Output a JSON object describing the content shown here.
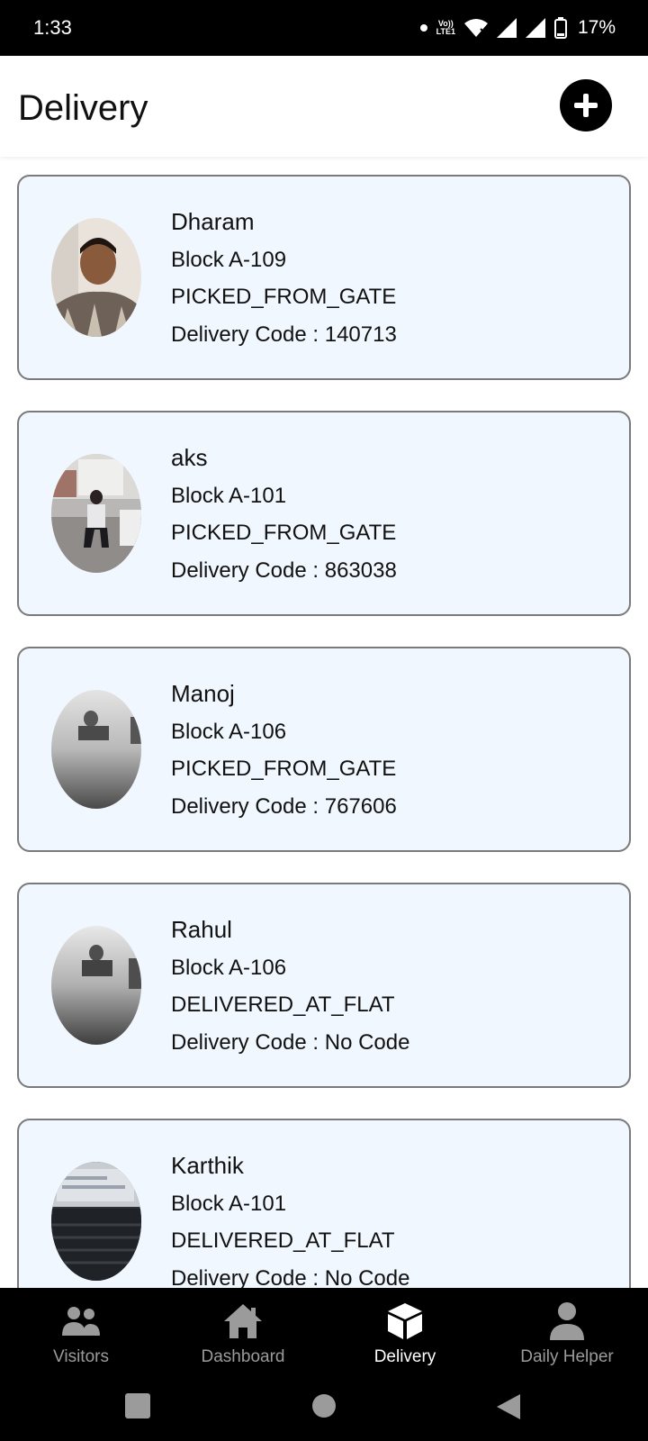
{
  "status_bar": {
    "time": "1:33",
    "network_label_top": "Vo))",
    "network_label_bottom": "LTE1",
    "battery": "17%"
  },
  "header": {
    "title": "Delivery",
    "add_icon": "plus-icon"
  },
  "deliveries": [
    {
      "name": "Dharam",
      "block": "Block A-109",
      "status": "PICKED_FROM_GATE",
      "code_label": "Delivery Code : ",
      "code": "140713"
    },
    {
      "name": "aks",
      "block": "Block A-101",
      "status": "PICKED_FROM_GATE",
      "code_label": "Delivery Code : ",
      "code": "863038"
    },
    {
      "name": "Manoj",
      "block": "Block A-106",
      "status": "PICKED_FROM_GATE",
      "code_label": "Delivery Code : ",
      "code": "767606"
    },
    {
      "name": "Rahul",
      "block": "Block A-106",
      "status": "DELIVERED_AT_FLAT",
      "code_label": "Delivery Code : ",
      "code": "No Code"
    },
    {
      "name": "Karthik",
      "block": "Block A-101",
      "status": "DELIVERED_AT_FLAT",
      "code_label": "Delivery Code : ",
      "code": "No Code"
    }
  ],
  "bottom_nav": [
    {
      "label": "Visitors",
      "icon": "people-icon",
      "active": false
    },
    {
      "label": "Dashboard",
      "icon": "home-icon",
      "active": false
    },
    {
      "label": "Delivery",
      "icon": "box-icon",
      "active": true
    },
    {
      "label": "Daily Helper",
      "icon": "person-icon",
      "active": false
    }
  ],
  "colors": {
    "card_background": "#f1f7fe",
    "card_border": "#7a7a7a",
    "nav_background": "#000000",
    "nav_active": "#ffffff",
    "nav_inactive": "#9b9b9b"
  }
}
